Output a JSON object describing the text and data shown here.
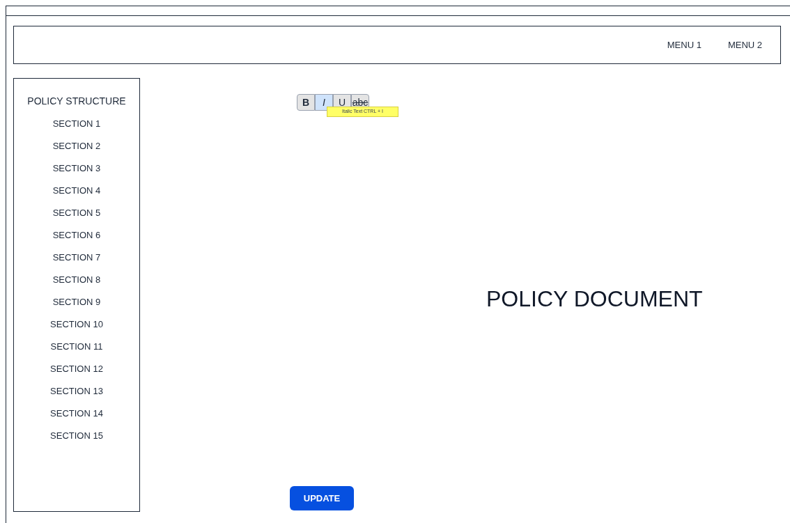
{
  "header": {
    "menu": [
      "MENU 1",
      "MENU 2"
    ]
  },
  "sidebar": {
    "title": "POLICY STRUCTURE",
    "items": [
      "SECTION 1",
      "SECTION 2",
      "SECTION 3",
      "SECTION 4",
      "SECTION 5",
      "SECTION 6",
      "SECTION 7",
      "SECTION 8",
      "SECTION 9",
      "SECTION 10",
      "SECTION 11",
      "SECTION 12",
      "SECTION 13",
      "SECTION 14",
      "SECTION 15"
    ]
  },
  "toolbar": {
    "buttons": [
      {
        "label": "B",
        "kind": "bold",
        "selected": false
      },
      {
        "label": "I",
        "kind": "italic",
        "selected": true
      },
      {
        "label": "U",
        "kind": "underline",
        "selected": false
      },
      {
        "label": "abc",
        "kind": "strike",
        "selected": false
      }
    ],
    "tooltip": "Italic Text CTRL + I"
  },
  "document": {
    "title": "POLICY DOCUMENT"
  },
  "update_button": "UPDATE"
}
